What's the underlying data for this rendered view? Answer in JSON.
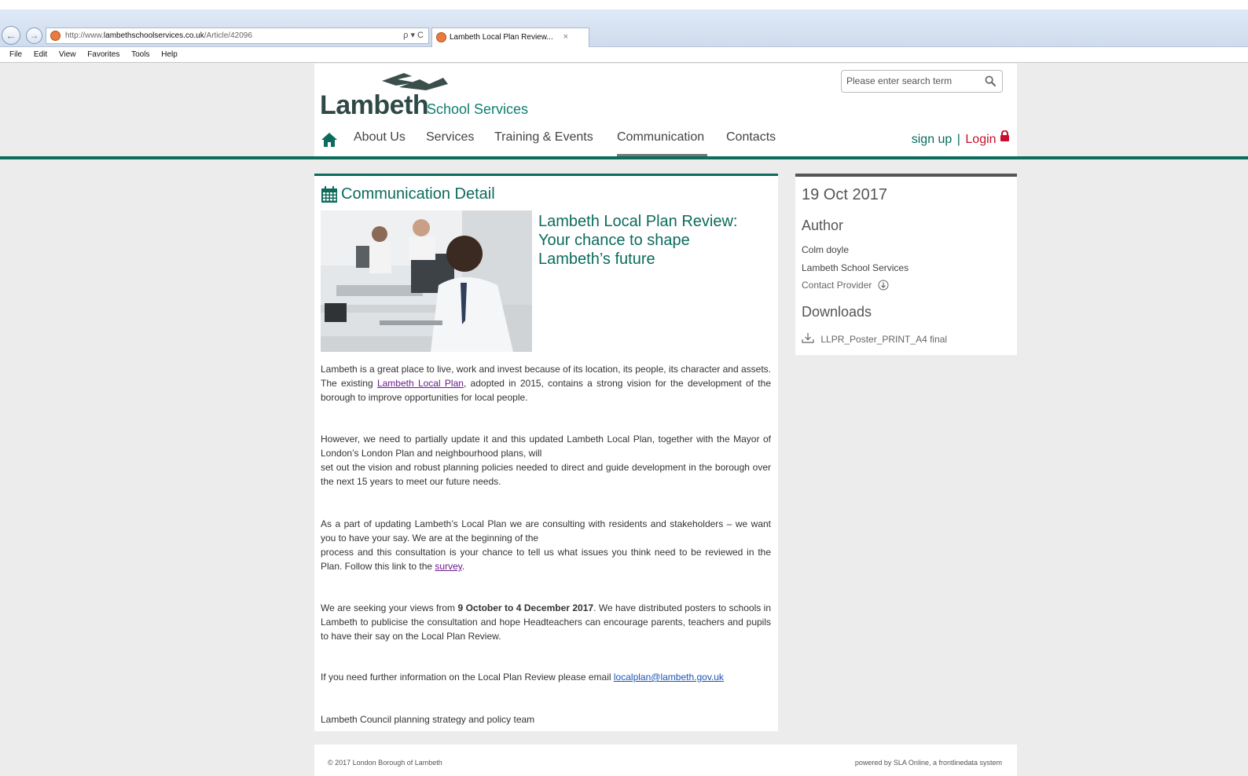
{
  "browser": {
    "url_prefix": "http://www.",
    "url_domain": "lambethschoolservices.co.uk",
    "url_path": "/Article/42096",
    "addr_tools": "ρ ▾ C",
    "tab_title": "Lambeth Local Plan Review...",
    "tab_close": "×",
    "menu": [
      "File",
      "Edit",
      "View",
      "Favorites",
      "Tools",
      "Help"
    ]
  },
  "header": {
    "logo_word": "Lambeth",
    "logo_sub": "School Services",
    "search_placeholder": "Please enter search term",
    "nav": [
      "About Us",
      "Services",
      "Training & Events",
      "Communication",
      "Contacts"
    ],
    "signup": "sign up",
    "separator": "|",
    "login": "Login"
  },
  "main": {
    "section_title": "Communication Detail",
    "article_title": "Lambeth Local Plan Review: Your chance to shape Lambeth’s future",
    "p1_a": "Lambeth is a great place to live, work and invest because of its location, its people, its character and assets. The existing ",
    "p1_link": "Lambeth Local Plan",
    "p1_b": ", adopted in 2015, contains a strong vision for the development of the borough to improve opportunities for local people.",
    "p2_a": "However, we need to partially update it and this updated Lambeth Local Plan, together with the Mayor of London’s London Plan and neighbourhood plans, will",
    "p2_b": "set out the vision and robust planning policies needed to direct and guide development in the borough over the next 15 years to meet our future needs.",
    "p3_a": "As a part of updating Lambeth’s Local Plan we are consulting with residents and stakeholders – we want you to have your say. We are at the beginning of the",
    "p3_b": "process and this consultation is your chance to tell us what issues you think need to be reviewed in the Plan. Follow this link to the ",
    "p3_link": "survey",
    "p3_end": ".",
    "p4_a": "We are seeking your views from ",
    "p4_bold": "9 October to 4 December 2017",
    "p4_b": ". We have distributed posters to schools in Lambeth to publicise the consultation and hope Headteachers can encourage parents, teachers and pupils to have their say on the Local Plan Review.",
    "p5_a": "If you need further information on the Local Plan Review please email ",
    "p5_link": "localplan@lambeth.gov.uk",
    "p6": "Lambeth Council planning strategy and policy team"
  },
  "side": {
    "date": "19 Oct 2017",
    "author_heading": "Author",
    "author_name": "Colm doyle",
    "author_org": "Lambeth School Services",
    "contact": "Contact Provider",
    "downloads_heading": "Downloads",
    "download_file": "LLPR_Poster_PRINT_A4 final"
  },
  "footer": {
    "copyright": "© 2017 London Borough of Lambeth",
    "powered": "powered by SLA Online, a frontlinedata system"
  },
  "colors": {
    "brand_green": "#0c6b5c",
    "login_red": "#c8102e",
    "link_purple": "#6b1a8c"
  }
}
